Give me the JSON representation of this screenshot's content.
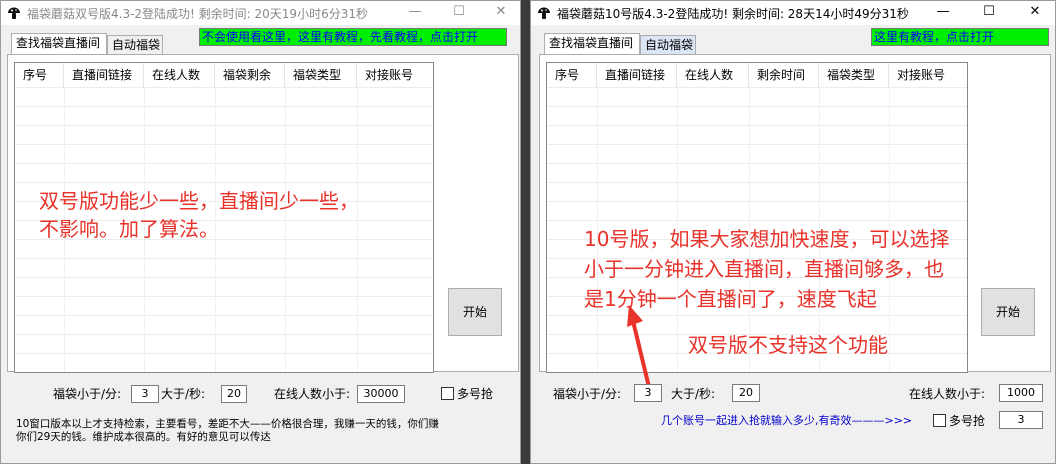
{
  "win1": {
    "title": "福袋蘑菇双号版4.3-2登陆成功! 剩余时间: 20天19小时6分31秒",
    "tabs": [
      "查找福袋直播间",
      "自动福袋"
    ],
    "notice": "不会使用看这里，这里有教程，先看教程，点击打开",
    "columns": [
      "序号",
      "直播间链接",
      "在线人数",
      "福袋剩余",
      "福袋类型",
      "对接账号"
    ],
    "annotation": [
      "双号版功能少一些，直播间少一些，",
      "不影响。加了算法。"
    ],
    "start_button": "开始",
    "label_bag_lt_min": "福袋小于/分:",
    "value_bag_lt_min": "3",
    "label_gt_sec": "大于/秒:",
    "value_gt_sec": "20",
    "label_online_lt": "在线人数小于:",
    "value_online_lt": "30000",
    "label_multi": "多号抢",
    "info_line1": "10窗口版本以上才支持检索，主要看号，差距不大——价格很合理，我赚一天的钱，你们赚",
    "info_line2": "你们29天的钱。维护成本很高的。有好的意见可以传达"
  },
  "win2": {
    "title": "福袋蘑菇10号版4.3-2登陆成功! 剩余时间: 28天14小时49分31秒",
    "tabs": [
      "查找福袋直播间",
      "自动福袋"
    ],
    "notice": "这里有教程，点击打开",
    "columns": [
      "序号",
      "直播间链接",
      "在线人数",
      "剩余时间",
      "福袋类型",
      "对接账号"
    ],
    "annotation": [
      "10号版，如果大家想加快速度，可以选择",
      "小于一分钟进入直播间，直播间够多，也",
      "是1分钟一个直播间了，速度飞起"
    ],
    "annotation2": "双号版不支持这个功能",
    "start_button": "开始",
    "label_bag_lt_min": "福袋小于/分:",
    "value_bag_lt_min": "3",
    "label_gt_sec": "大于/秒:",
    "value_gt_sec": "20",
    "label_online_lt": "在线人数小于:",
    "value_online_lt": "1000",
    "multi_hint": "几个账号一起进入抢就输入多少,有奇效———>>>",
    "label_multi": "多号抢",
    "value_multi": "3"
  },
  "colors": {
    "accent_red": "#e8322a",
    "notice_green": "#00ee00",
    "link_blue": "#0000cc"
  },
  "icons": [
    "mushroom-icon",
    "minimize-icon",
    "maximize-icon",
    "close-icon",
    "arrow-up-icon"
  ]
}
